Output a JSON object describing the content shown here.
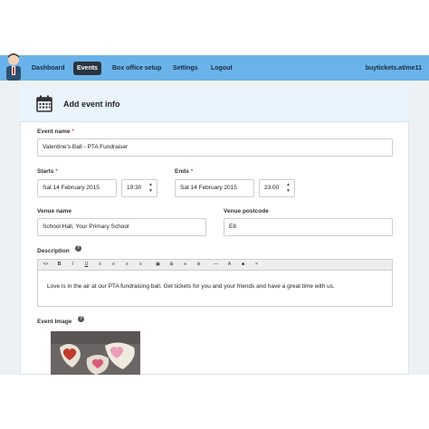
{
  "nav": {
    "items": [
      {
        "label": "Dashboard",
        "active": false
      },
      {
        "label": "Events",
        "active": true
      },
      {
        "label": "Box office setup",
        "active": false
      },
      {
        "label": "Settings",
        "active": false
      },
      {
        "label": "Logout",
        "active": false
      }
    ],
    "site_url": "buytickets.at/me11"
  },
  "card": {
    "title": "Add event info",
    "icon": "calendar-icon"
  },
  "form": {
    "event_name": {
      "label": "Event name",
      "required_mark": "*",
      "value": "Valentine's Ball - PTA Fundraiser"
    },
    "starts": {
      "label": "Starts",
      "required_mark": "*",
      "date": "Sat 14 February 2015",
      "time": "19:30"
    },
    "ends": {
      "label": "Ends",
      "required_mark": "*",
      "date": "Sat 14 February 2015",
      "time": "23:00"
    },
    "venue_name": {
      "label": "Venue name",
      "value": "School Hall, Your Primary School"
    },
    "venue_postcode": {
      "label": "Venue postcode",
      "value": "E8"
    },
    "description": {
      "label": "Description",
      "help_glyph": "?",
      "toolbar": [
        "<>",
        "B",
        "I",
        "U",
        "≡",
        "≡",
        "≡",
        "≡",
        "▣",
        "⊞",
        "∞",
        "⊘",
        "—",
        "A",
        "■",
        "×"
      ],
      "value": "Love is in the air at our PTA fundraising ball. Get tickets for you and your friends and have a great time with us."
    },
    "event_image": {
      "label": "Event Image",
      "help_glyph": "?"
    }
  },
  "colors": {
    "topbar": "#6ab3ea",
    "active_tab": "#2a3440",
    "header_band": "#eaf4fd",
    "required": "#d9534f"
  }
}
